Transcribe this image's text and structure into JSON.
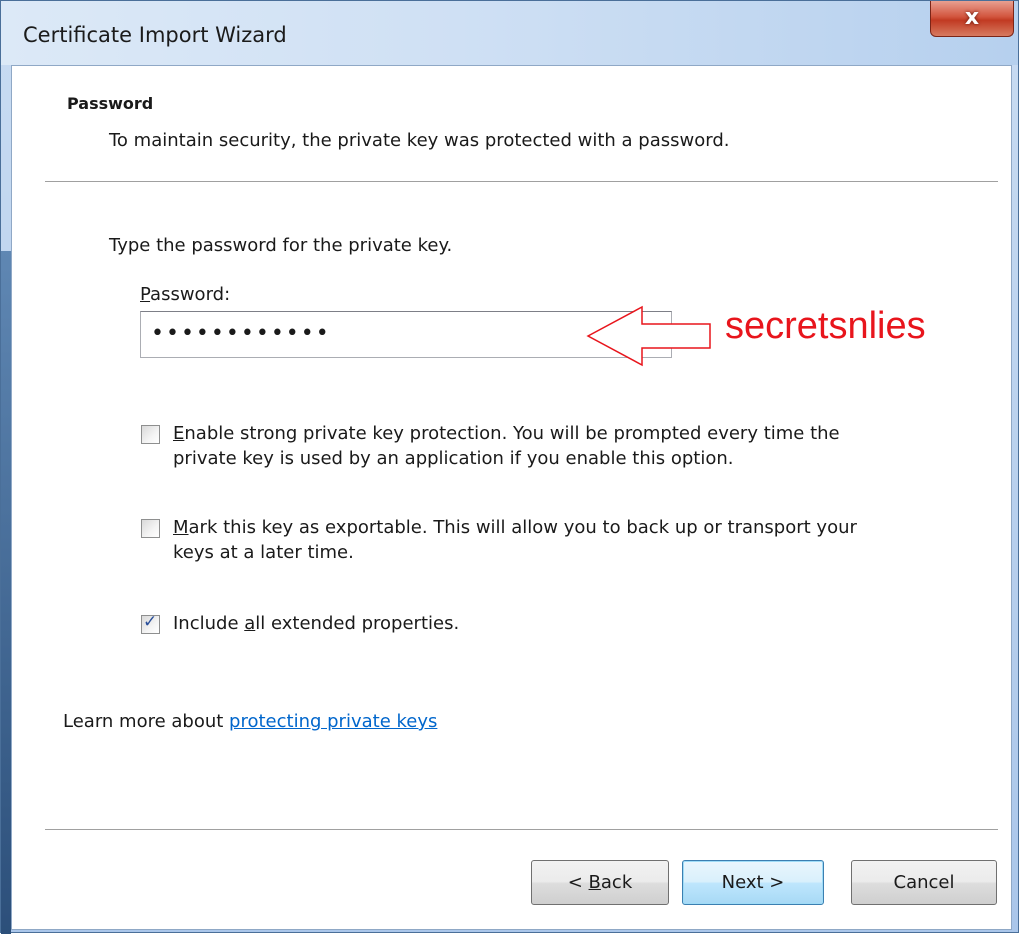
{
  "window": {
    "title": "Certificate Import Wizard",
    "close_label": "x"
  },
  "header": {
    "title": "Password",
    "subtitle": "To maintain security, the private key was protected with a password."
  },
  "main": {
    "prompt": "Type the password for the private key.",
    "password_label_mnemonic": "P",
    "password_label_rest": "assword:",
    "password_value": "••••••••••••",
    "annotation_text": "secretsnlies",
    "annotation_color": "#e8151c",
    "options": [
      {
        "mnemonic": "E",
        "line1_rest": "nable strong private key protection. You will be prompted every time the",
        "line2": "private key is used by an application if you enable this option.",
        "checked": false
      },
      {
        "mnemonic": "M",
        "line1_rest": "ark this key as exportable. This will allow you to back up or transport your",
        "line2": "keys at a later time.",
        "checked": false
      },
      {
        "line1_before": "Include ",
        "mnemonic": "a",
        "line1_after": "ll extended properties.",
        "checked": true
      }
    ],
    "learn_prefix": "Learn more about ",
    "learn_link": "protecting private keys"
  },
  "footer": {
    "back_prefix": "< ",
    "back_mnemonic": "B",
    "back_rest": "ack",
    "next_label": "Next >",
    "cancel_label": "Cancel"
  }
}
